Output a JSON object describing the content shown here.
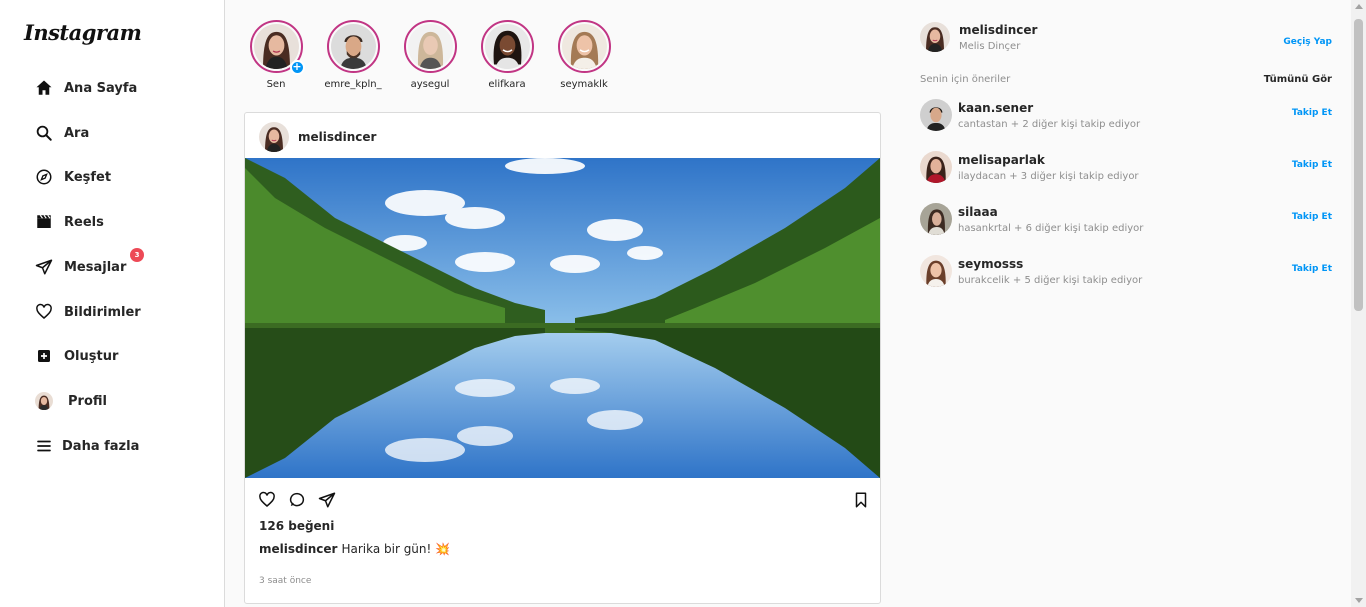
{
  "brand": {
    "logo_text": "Instagram"
  },
  "sidebar": {
    "items": [
      {
        "label": "Ana Sayfa",
        "icon": "home-icon"
      },
      {
        "label": "Ara",
        "icon": "search-icon"
      },
      {
        "label": "Keşfet",
        "icon": "compass-icon"
      },
      {
        "label": "Reels",
        "icon": "reels-icon"
      },
      {
        "label": "Mesajlar",
        "icon": "send-icon",
        "badge": "3"
      },
      {
        "label": "Bildirimler",
        "icon": "heart-icon"
      },
      {
        "label": "Oluştur",
        "icon": "plus-square-icon"
      },
      {
        "label": "Profil",
        "icon": "profile-avatar"
      },
      {
        "label": "Daha fazla",
        "icon": "menu-icon"
      }
    ]
  },
  "stories": [
    {
      "name": "Sen"
    },
    {
      "name": "emre_kpln_"
    },
    {
      "name": "aysegul"
    },
    {
      "name": "elifkara"
    },
    {
      "name": "seymaklk"
    }
  ],
  "post": {
    "username": "melisdincer",
    "likes": "126 beğeni",
    "caption_user": "melisdincer",
    "caption_text": "Harika bir gün! 💥",
    "time": "3 saat önce"
  },
  "right": {
    "me": {
      "username": "melisdincer",
      "full_name": "Melis Dinçer",
      "switch_label": "Geçiş Yap"
    },
    "suggestions_title": "Senin için öneriler",
    "see_all": "Tümünü Gör",
    "suggestions": [
      {
        "username": "kaan.sener",
        "subtitle": "cantastan + 2 diğer kişi takip ediyor",
        "follow": "Takip Et"
      },
      {
        "username": "melisaparlak",
        "subtitle": "ilaydacan + 3 diğer kişi takip ediyor",
        "follow": "Takip Et"
      },
      {
        "username": "silaaa",
        "subtitle": "hasankrtal + 6 diğer kişi takip ediyor",
        "follow": "Takip Et"
      },
      {
        "username": "seymosss",
        "subtitle": "burakcelik + 5 diğer kişi takip ediyor",
        "follow": "Takip Et"
      }
    ]
  },
  "colors": {
    "accent": "#0095f6",
    "story_ring": "#c13584",
    "badge": "#ed4956"
  }
}
